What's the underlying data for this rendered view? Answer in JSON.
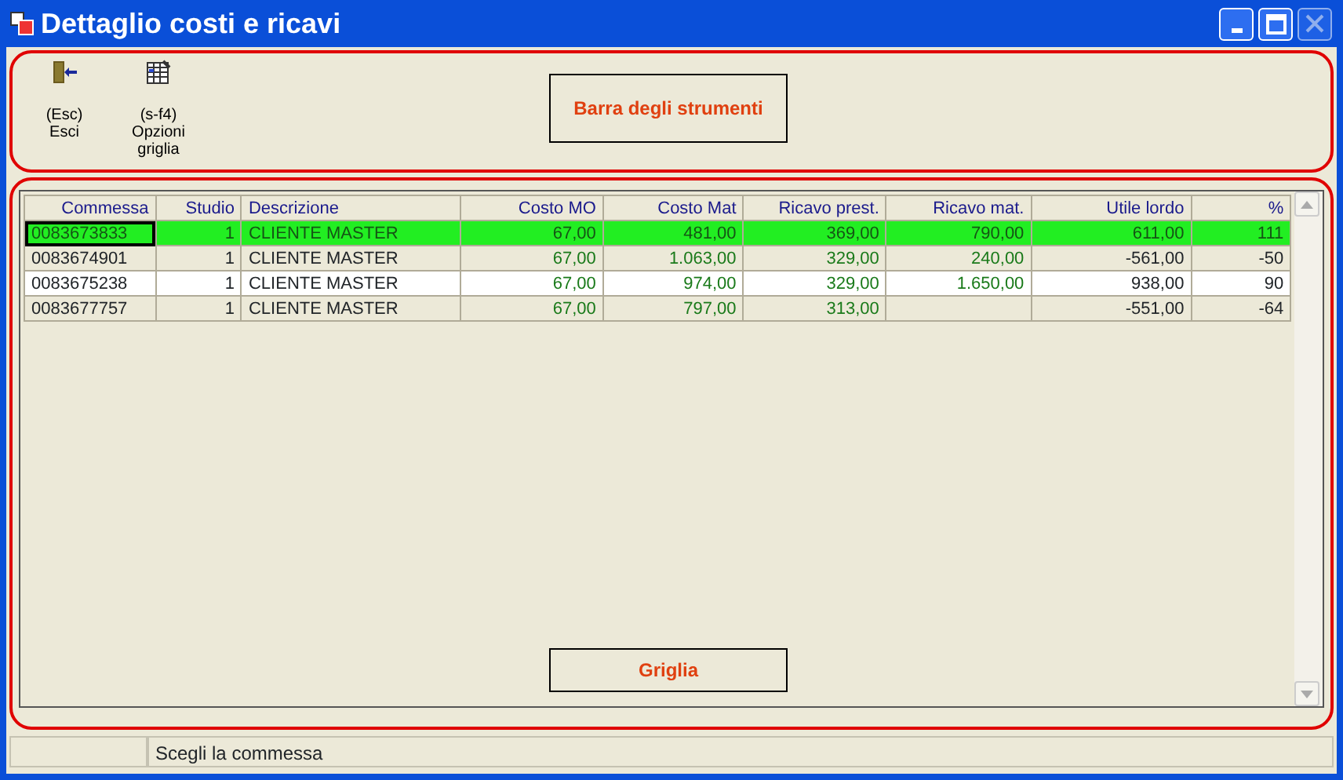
{
  "window": {
    "title": "Dettaglio costi e ricavi",
    "close_disabled": true
  },
  "toolbar": {
    "buttons": [
      {
        "key": "(Esc)",
        "label": "Esci",
        "kind": "exit"
      },
      {
        "key": "(s-f4)",
        "label": "Opzioni griglia",
        "kind": "grid"
      }
    ]
  },
  "callouts": [
    "Barra degli strumenti",
    "Griglia"
  ],
  "table": {
    "columns": [
      {
        "label": "Commessa",
        "kind": "text"
      },
      {
        "label": "Studio",
        "kind": "number"
      },
      {
        "label": "Descrizione",
        "kind": "text"
      },
      {
        "label": "Costo MO",
        "kind": "money"
      },
      {
        "label": "Costo Mat",
        "kind": "money"
      },
      {
        "label": "Ricavo prest.",
        "kind": "money"
      },
      {
        "label": "Ricavo mat.",
        "kind": "money"
      },
      {
        "label": "Utile lordo",
        "kind": "number"
      },
      {
        "label": "%",
        "kind": "number"
      }
    ],
    "rows": [
      {
        "selected": true,
        "cells": [
          "0083673833",
          "1",
          "CLIENTE MASTER",
          "67,00",
          "481,00",
          "369,00",
          "790,00",
          "611,00",
          "111"
        ]
      },
      {
        "selected": false,
        "cells": [
          "0083674901",
          "1",
          "CLIENTE MASTER",
          "67,00",
          "1.063,00",
          "329,00",
          "240,00",
          "-561,00",
          "-50"
        ]
      },
      {
        "selected": false,
        "cells": [
          "0083675238",
          "1",
          "CLIENTE MASTER",
          "67,00",
          "974,00",
          "329,00",
          "1.650,00",
          "938,00",
          "90"
        ]
      },
      {
        "selected": false,
        "cells": [
          "0083677757",
          "1",
          "CLIENTE MASTER",
          "67,00",
          "797,00",
          "313,00",
          "",
          "-551,00",
          "-64"
        ]
      }
    ]
  },
  "status_bar": {
    "message": "Scegli la commessa"
  }
}
